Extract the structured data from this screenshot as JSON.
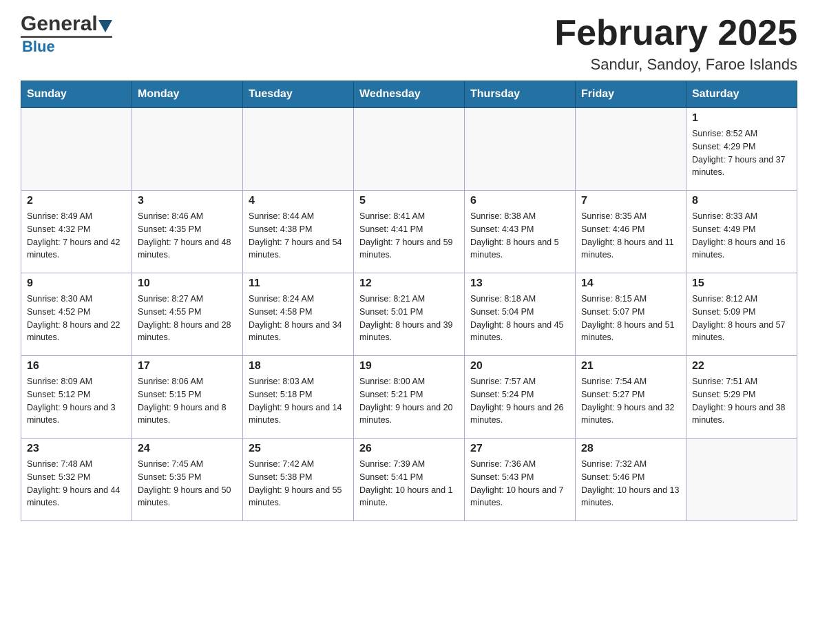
{
  "header": {
    "logo_general": "General",
    "logo_blue": "Blue",
    "month_title": "February 2025",
    "location": "Sandur, Sandoy, Faroe Islands"
  },
  "days_of_week": [
    "Sunday",
    "Monday",
    "Tuesday",
    "Wednesday",
    "Thursday",
    "Friday",
    "Saturday"
  ],
  "weeks": [
    [
      {
        "day": "",
        "info": ""
      },
      {
        "day": "",
        "info": ""
      },
      {
        "day": "",
        "info": ""
      },
      {
        "day": "",
        "info": ""
      },
      {
        "day": "",
        "info": ""
      },
      {
        "day": "",
        "info": ""
      },
      {
        "day": "1",
        "info": "Sunrise: 8:52 AM\nSunset: 4:29 PM\nDaylight: 7 hours and 37 minutes."
      }
    ],
    [
      {
        "day": "2",
        "info": "Sunrise: 8:49 AM\nSunset: 4:32 PM\nDaylight: 7 hours and 42 minutes."
      },
      {
        "day": "3",
        "info": "Sunrise: 8:46 AM\nSunset: 4:35 PM\nDaylight: 7 hours and 48 minutes."
      },
      {
        "day": "4",
        "info": "Sunrise: 8:44 AM\nSunset: 4:38 PM\nDaylight: 7 hours and 54 minutes."
      },
      {
        "day": "5",
        "info": "Sunrise: 8:41 AM\nSunset: 4:41 PM\nDaylight: 7 hours and 59 minutes."
      },
      {
        "day": "6",
        "info": "Sunrise: 8:38 AM\nSunset: 4:43 PM\nDaylight: 8 hours and 5 minutes."
      },
      {
        "day": "7",
        "info": "Sunrise: 8:35 AM\nSunset: 4:46 PM\nDaylight: 8 hours and 11 minutes."
      },
      {
        "day": "8",
        "info": "Sunrise: 8:33 AM\nSunset: 4:49 PM\nDaylight: 8 hours and 16 minutes."
      }
    ],
    [
      {
        "day": "9",
        "info": "Sunrise: 8:30 AM\nSunset: 4:52 PM\nDaylight: 8 hours and 22 minutes."
      },
      {
        "day": "10",
        "info": "Sunrise: 8:27 AM\nSunset: 4:55 PM\nDaylight: 8 hours and 28 minutes."
      },
      {
        "day": "11",
        "info": "Sunrise: 8:24 AM\nSunset: 4:58 PM\nDaylight: 8 hours and 34 minutes."
      },
      {
        "day": "12",
        "info": "Sunrise: 8:21 AM\nSunset: 5:01 PM\nDaylight: 8 hours and 39 minutes."
      },
      {
        "day": "13",
        "info": "Sunrise: 8:18 AM\nSunset: 5:04 PM\nDaylight: 8 hours and 45 minutes."
      },
      {
        "day": "14",
        "info": "Sunrise: 8:15 AM\nSunset: 5:07 PM\nDaylight: 8 hours and 51 minutes."
      },
      {
        "day": "15",
        "info": "Sunrise: 8:12 AM\nSunset: 5:09 PM\nDaylight: 8 hours and 57 minutes."
      }
    ],
    [
      {
        "day": "16",
        "info": "Sunrise: 8:09 AM\nSunset: 5:12 PM\nDaylight: 9 hours and 3 minutes."
      },
      {
        "day": "17",
        "info": "Sunrise: 8:06 AM\nSunset: 5:15 PM\nDaylight: 9 hours and 8 minutes."
      },
      {
        "day": "18",
        "info": "Sunrise: 8:03 AM\nSunset: 5:18 PM\nDaylight: 9 hours and 14 minutes."
      },
      {
        "day": "19",
        "info": "Sunrise: 8:00 AM\nSunset: 5:21 PM\nDaylight: 9 hours and 20 minutes."
      },
      {
        "day": "20",
        "info": "Sunrise: 7:57 AM\nSunset: 5:24 PM\nDaylight: 9 hours and 26 minutes."
      },
      {
        "day": "21",
        "info": "Sunrise: 7:54 AM\nSunset: 5:27 PM\nDaylight: 9 hours and 32 minutes."
      },
      {
        "day": "22",
        "info": "Sunrise: 7:51 AM\nSunset: 5:29 PM\nDaylight: 9 hours and 38 minutes."
      }
    ],
    [
      {
        "day": "23",
        "info": "Sunrise: 7:48 AM\nSunset: 5:32 PM\nDaylight: 9 hours and 44 minutes."
      },
      {
        "day": "24",
        "info": "Sunrise: 7:45 AM\nSunset: 5:35 PM\nDaylight: 9 hours and 50 minutes."
      },
      {
        "day": "25",
        "info": "Sunrise: 7:42 AM\nSunset: 5:38 PM\nDaylight: 9 hours and 55 minutes."
      },
      {
        "day": "26",
        "info": "Sunrise: 7:39 AM\nSunset: 5:41 PM\nDaylight: 10 hours and 1 minute."
      },
      {
        "day": "27",
        "info": "Sunrise: 7:36 AM\nSunset: 5:43 PM\nDaylight: 10 hours and 7 minutes."
      },
      {
        "day": "28",
        "info": "Sunrise: 7:32 AM\nSunset: 5:46 PM\nDaylight: 10 hours and 13 minutes."
      },
      {
        "day": "",
        "info": ""
      }
    ]
  ]
}
